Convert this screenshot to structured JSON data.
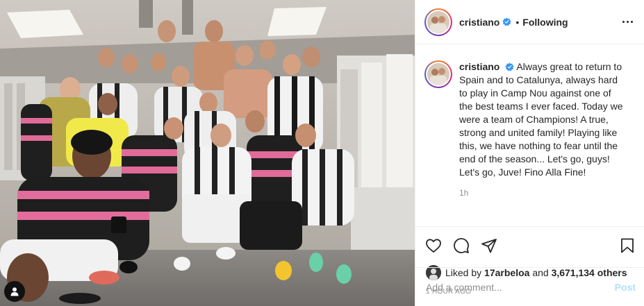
{
  "header": {
    "username": "cristiano",
    "separator": "•",
    "follow_state": "Following"
  },
  "caption": {
    "username": "cristiano",
    "text": "Always great to return to Spain and to Catalunya, always hard to play in Camp Nou against one of the best teams I ever faced. Today we were a team of Champions! A true, strong and united family! Playing like this, we have nothing to fear until the end of the season... Let's go, guys! Let's go, Juve! Fino Alla Fine!",
    "time": "1h"
  },
  "likes": {
    "prefix": "Liked by",
    "liker": "17arbeloa",
    "joiner": "and",
    "others": "3,671,134 others"
  },
  "post_time": "1 HOUR AGO",
  "comment": {
    "placeholder": "Add a comment...",
    "post_label": "Post"
  },
  "icons": {
    "verified": "verified-badge-icon",
    "like": "heart-icon",
    "comment": "comment-bubble-icon",
    "share": "paper-plane-icon",
    "save": "bookmark-icon",
    "more": "more-options-icon",
    "tag": "user-tag-icon"
  },
  "colors": {
    "verified_blue": "#3897f0",
    "post_button_disabled": "#b2dffc",
    "secondary_text": "#8e8e8e"
  }
}
